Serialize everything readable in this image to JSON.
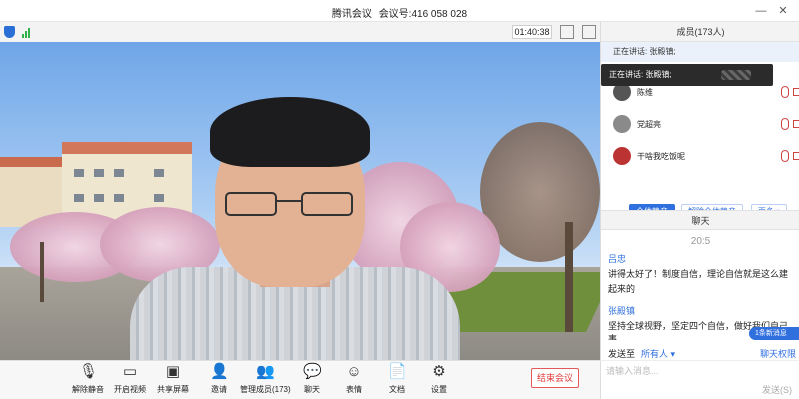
{
  "window": {
    "title": "腾讯会议",
    "meeting_id_label": "会议号:",
    "meeting_id": "416 058 028",
    "minimize_glyph": "—",
    "close_glyph": "✕"
  },
  "topbar": {
    "timer": "01:40:38",
    "shield_icon": "shield-icon",
    "signal_icon": "signal-icon"
  },
  "toolbar": {
    "buttons": [
      {
        "icon": "mic-muted-icon",
        "label": "解除静音"
      },
      {
        "icon": "video-off-icon",
        "label": "开启视频"
      },
      {
        "icon": "share-screen-icon",
        "label": "共享屏幕"
      },
      {
        "icon": "invite-icon",
        "label": "邀请"
      },
      {
        "icon": "members-icon",
        "label": "管理成员(173)"
      },
      {
        "icon": "chat-icon",
        "label": "聊天"
      },
      {
        "icon": "emoji-icon",
        "label": "表情"
      },
      {
        "icon": "document-icon",
        "label": "文档"
      },
      {
        "icon": "settings-icon",
        "label": "设置"
      }
    ],
    "end_meeting": "结束会议"
  },
  "members_panel": {
    "header": "成员(173人)",
    "speaking": "正在讲话: 张殿镇;",
    "tooltip": "正在讲话: 张殿镇;",
    "members": [
      {
        "name": "陈维"
      },
      {
        "name": "党超亮"
      },
      {
        "name": "干啥我吃饭呢"
      }
    ],
    "mute_all": "全体静音",
    "unmute_all": "解除全体静音",
    "more": "更多 ▾"
  },
  "chat_panel": {
    "header": "聊天",
    "time": "20:5",
    "messages": [
      {
        "sender": "吕忠",
        "lines": [
          "讲得太好了！制度自信，理论自信就是这么建",
          "起来的"
        ]
      },
      {
        "sender": "张殿镇",
        "lines": [
          "坚持全球视野，坚定四个自信，做好我们自己",
          "事"
        ]
      }
    ],
    "new_message_badge": "1条新消息",
    "send_to_label": "发送至",
    "send_to_target": "所有人 ▾",
    "private_chat": "聊天权限",
    "input_placeholder": "请输入消息...",
    "send_button": "发送(S)"
  }
}
